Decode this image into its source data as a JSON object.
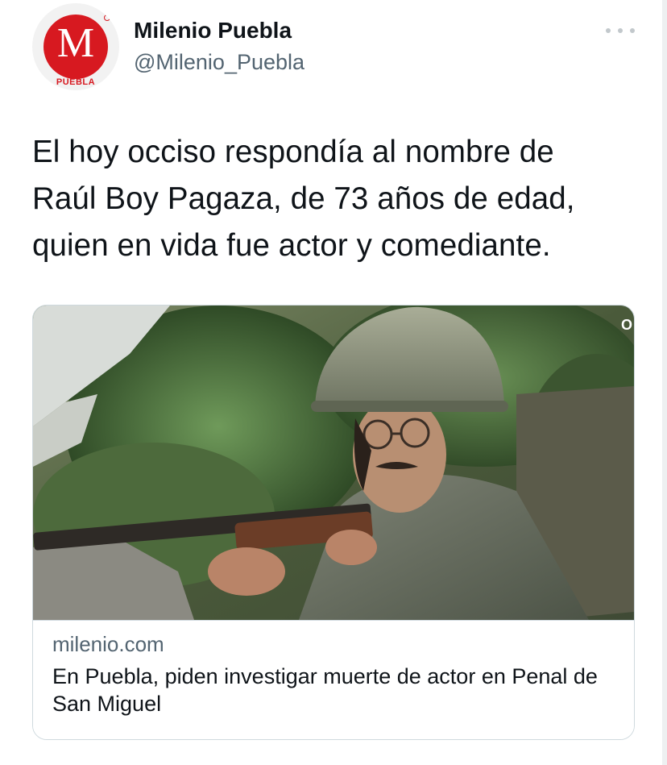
{
  "account": {
    "name": "Milenio Puebla",
    "handle": "@Milenio_Puebla",
    "avatar_letter": "M",
    "avatar_subtitle": "PUEBLA"
  },
  "tweet": {
    "text_lines": [
      "El hoy occiso respondía al nombre de",
      "Raúl Boy Pagaza, de 73 años de edad,",
      "quien en vida fue actor y comediante."
    ]
  },
  "card": {
    "domain": "milenio.com",
    "headline": "En Puebla, piden investigar muerte de actor en Penal de San Miguel",
    "image_corner_text": "O"
  },
  "icons": {
    "more": "more-horizontal-icon"
  },
  "colors": {
    "brand_red": "#d71920",
    "text_primary": "#0f1419",
    "text_secondary": "#536471",
    "border": "#cfd9de"
  }
}
